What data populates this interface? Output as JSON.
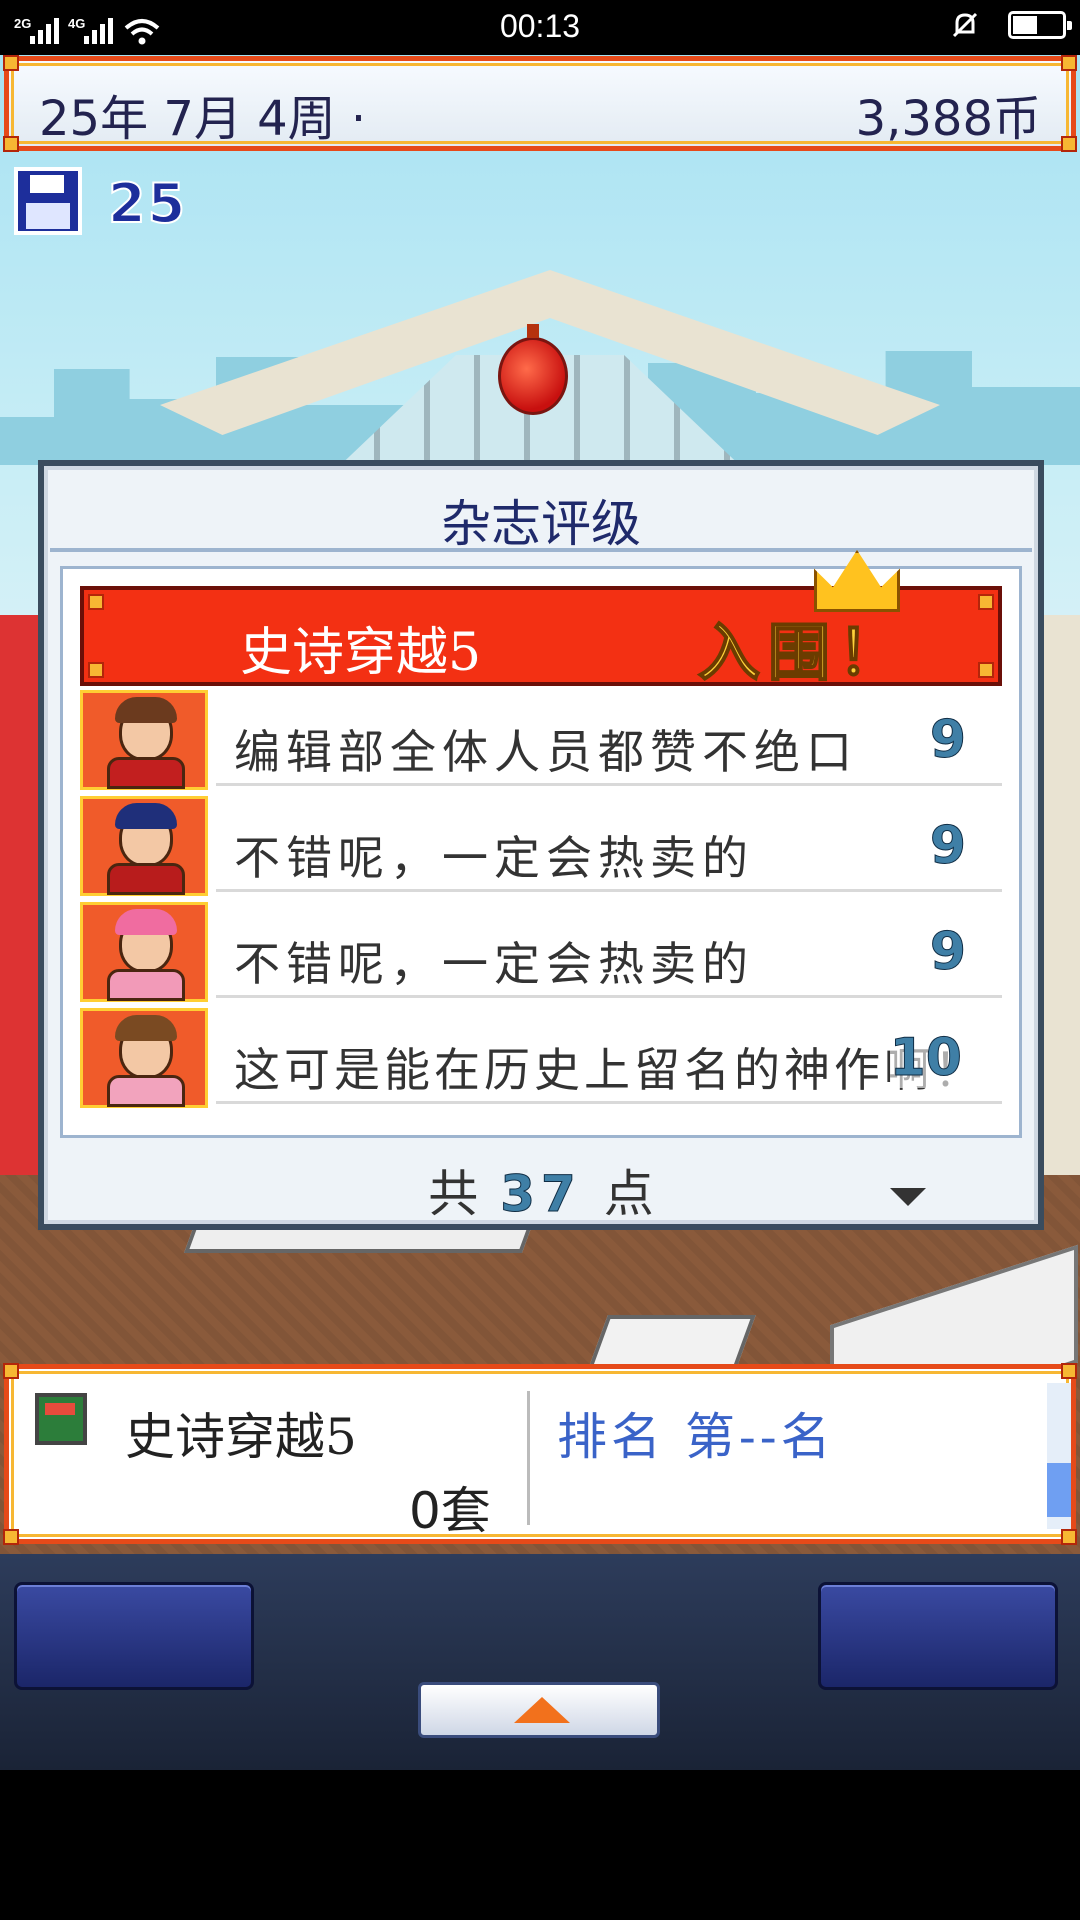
{
  "status_bar": {
    "time": "00:13",
    "signal_1_label": "2G",
    "signal_2_label": "4G",
    "battery_level_pct": 50
  },
  "hud": {
    "date": "25年 7月 4周 ·",
    "money": "3,388币",
    "save_count": "25"
  },
  "dialog": {
    "title": "杂志评级",
    "magazine_name": "史诗穿越5",
    "award_text": "入围！",
    "reviews": [
      {
        "comment": "编辑部全体人员都赞不绝口",
        "score": "9"
      },
      {
        "comment": "不错呢，一定会热卖的",
        "score": "9"
      },
      {
        "comment": "不错呢，一定会热卖的",
        "score": "9"
      },
      {
        "comment": "这可是能在历史上留名的神作啊！",
        "score": "10"
      }
    ],
    "total_prefix": "共",
    "total_points": "37",
    "total_suffix": "点"
  },
  "info_panel": {
    "magazine_name": "史诗穿越5",
    "sets": "0套",
    "rank": "排名 第--名"
  },
  "colors": {
    "frame_orange": "#e64a19",
    "frame_gold": "#f7b733",
    "header_red": "#f33013",
    "score_blue": "#3f7fa6",
    "rank_blue": "#3a63c8"
  },
  "icons": [
    "save-icon",
    "crown-icon",
    "magazine-icon",
    "up-arrow-icon",
    "more-arrow-icon"
  ]
}
